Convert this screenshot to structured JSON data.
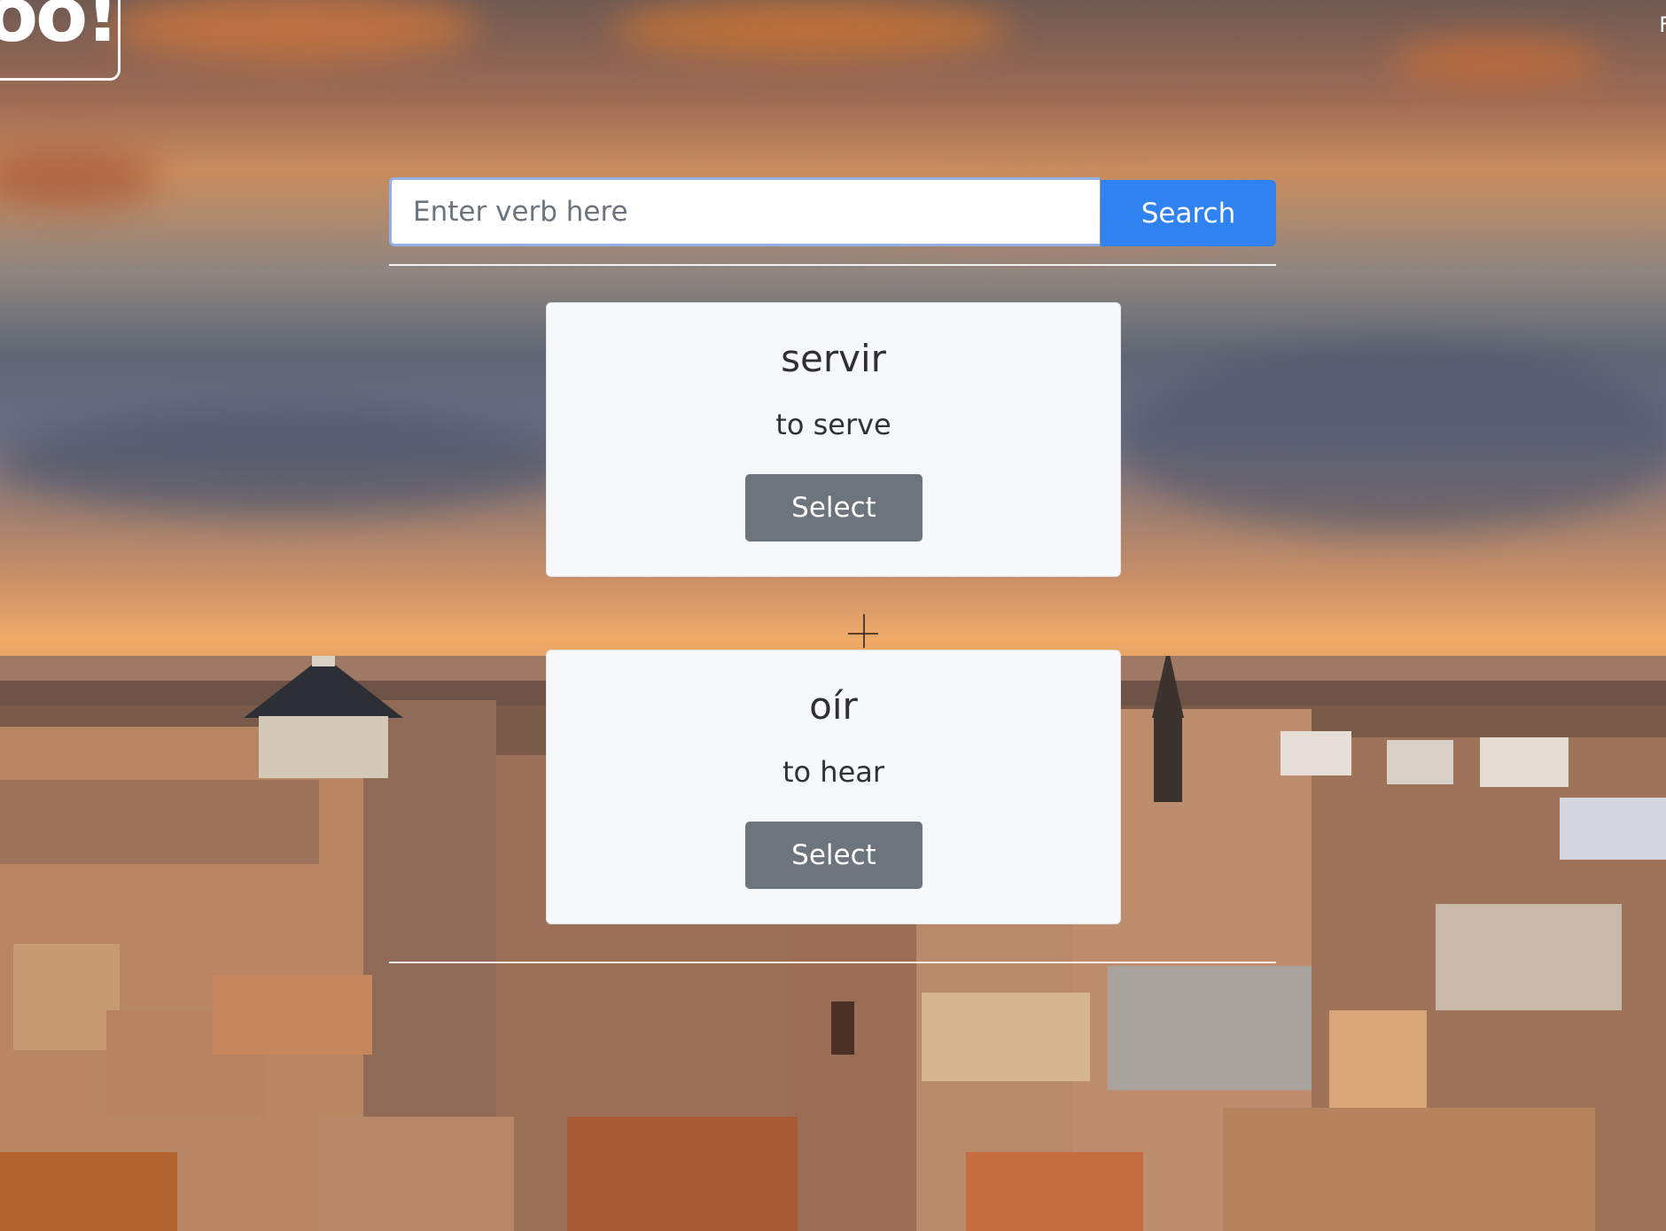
{
  "brand": {
    "logo_text": "oo!"
  },
  "header": {
    "right_text": "F"
  },
  "search": {
    "placeholder": "Enter verb here",
    "button_label": "Search"
  },
  "results": [
    {
      "verb": "servir",
      "meaning": "to serve",
      "button_label": "Select"
    },
    {
      "verb": "oír",
      "meaning": "to hear",
      "button_label": "Select"
    }
  ],
  "colors": {
    "search_button": "#2f82f0",
    "select_button": "#6c757d",
    "card_background": "#f7f8fa"
  }
}
